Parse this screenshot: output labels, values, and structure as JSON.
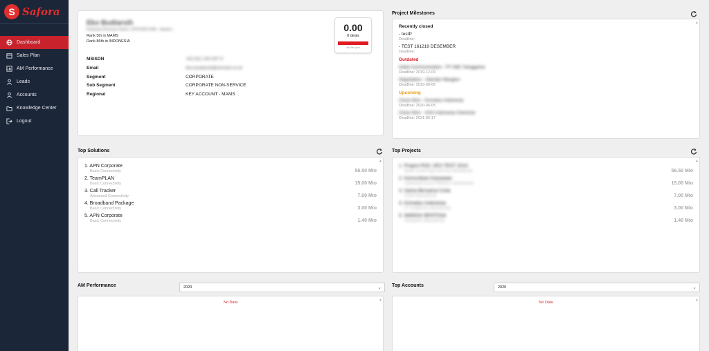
{
  "brand": {
    "name": "Safora"
  },
  "sidebar": {
    "items": [
      {
        "label": "Dashboard",
        "icon": "globe-icon",
        "active": true
      },
      {
        "label": "Sales Plan",
        "icon": "calendar-icon"
      },
      {
        "label": "AM Performance",
        "icon": "chart-icon"
      },
      {
        "label": "Leads",
        "icon": "user-icon"
      },
      {
        "label": "Accounts",
        "icon": "account-icon"
      },
      {
        "label": "Knowledge Center",
        "icon": "folder-icon"
      },
      {
        "label": "Logout",
        "icon": "logout-icon"
      }
    ]
  },
  "profile": {
    "name": "Eko Budiarsih",
    "role": "Enterprise Revenue Hunter ( OFFICER1 B2B - Jakarta )",
    "rank1": "Rank 5th in MAMS",
    "rank2": "Rank 86th in INDONESIA",
    "fields": [
      {
        "key": "MSISDN",
        "value": "+62 811 100 007 9"
      },
      {
        "key": "Email",
        "value": "eko.budiarsih@xlsmart.co.id"
      },
      {
        "key": "Segment",
        "value": "CORPORATE"
      },
      {
        "key": "Sub Segment",
        "value": "CORPORATE NON-SERVICE"
      },
      {
        "key": "Regional",
        "value": "KEY ACCOUNT - MAMS"
      }
    ],
    "score": {
      "value": "0.00",
      "deals": "0 deals",
      "caption": "last this year"
    }
  },
  "milestones": {
    "title": "Project Milestones",
    "recent_heading": "Recently closed",
    "recent": [
      {
        "title": "- testP",
        "deadline": "Deadline:"
      },
      {
        "title": "- TEST 161219 DESEMBER",
        "deadline": "Deadline:"
      }
    ],
    "outdated_heading": "Outdated",
    "outdated": [
      {
        "title": "Initial Communication - PT ABC Sanggama",
        "deadline": "Deadline: 2019-12-09"
      },
      {
        "title": "Negotiation - Standar Wasgion",
        "deadline": "Deadline: 2019-09-06"
      }
    ],
    "upcoming_heading": "Upcoming",
    "upcoming": [
      {
        "title": "Close Won - Kumatsu Indonesia",
        "deadline": "Deadline: 2020-06-05"
      },
      {
        "title": "Close Won - XAG Indonesia Chemical",
        "deadline": "Deadline: 2021-05-17"
      }
    ]
  },
  "top_solutions": {
    "title": "Top Solutions",
    "items": [
      {
        "name": "1. APN Corporate",
        "sub": "Basic Connectivity",
        "value": "56.50 Mio"
      },
      {
        "name": "2. TeamPLAN",
        "sub": "Basic Connectivity",
        "value": "15.00 Mio"
      },
      {
        "name": "3. Call Tracker",
        "sub": "Advanced Connectivity",
        "value": "7.00 Mio"
      },
      {
        "name": "4. Broadband Package",
        "sub": "Basic Connectivity",
        "value": "3.00 Mio"
      },
      {
        "name": "5. APN Corporate",
        "sub": "Basic Connectivity",
        "value": "1.40 Mio"
      }
    ]
  },
  "top_projects": {
    "title": "Top Projects",
    "items": [
      {
        "name": "1. Project POC VES TEST 2010",
        "sub": "BANK SUMITOMO MITSUI INDONESIA",
        "value": "56.50 Mio"
      },
      {
        "name": "2. Komunikasi Karyawan",
        "sub": "SAMSUNG ELECTRONICS INDONESIA",
        "value": "15.00 Mio"
      },
      {
        "name": "3. Sama Bersama Cinta",
        "sub": "SSSP INDONESIA",
        "value": "7.00 Mio"
      },
      {
        "name": "4. Komatsu Indonesia",
        "sub": "PT KOMATSU INDONESIA",
        "value": "3.00 Mio"
      },
      {
        "name": "5. WARDA SENTOSA",
        "sub": "SHISEIDO INDONESIA",
        "value": "1.40 Mio"
      }
    ]
  },
  "am_performance": {
    "title": "AM Performance",
    "year": "2020",
    "empty": "No Data"
  },
  "top_accounts": {
    "title": "Top Accounts",
    "year": "2020",
    "empty": "No Data"
  }
}
